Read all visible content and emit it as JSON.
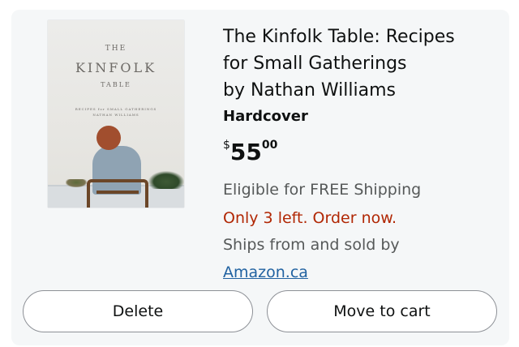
{
  "product": {
    "cover": {
      "line1": "THE",
      "line2": "KINFOLK",
      "line3": "TABLE",
      "line4": "RECIPES for SMALL GATHERINGS",
      "line5": "NATHAN WILLIAMS"
    },
    "title_line1": "The Kinfolk Table: Recipes",
    "title_line2": "for Small Gatherings",
    "title_line3": "by Nathan Williams",
    "format": "Hardcover",
    "price": {
      "symbol": "$",
      "whole": "55",
      "fraction": "00"
    },
    "shipping": "Eligible for FREE Shipping",
    "stock": "Only 3 left. Order now.",
    "sold_by": "Ships from and sold by",
    "seller_link": "Amazon.ca"
  },
  "actions": {
    "delete_label": "Delete",
    "move_label": "Move to cart"
  },
  "colors": {
    "card_background": "#f5f7f8",
    "stock_warning": "#b12704",
    "link": "#2162a1",
    "secondary_text": "#565959"
  }
}
